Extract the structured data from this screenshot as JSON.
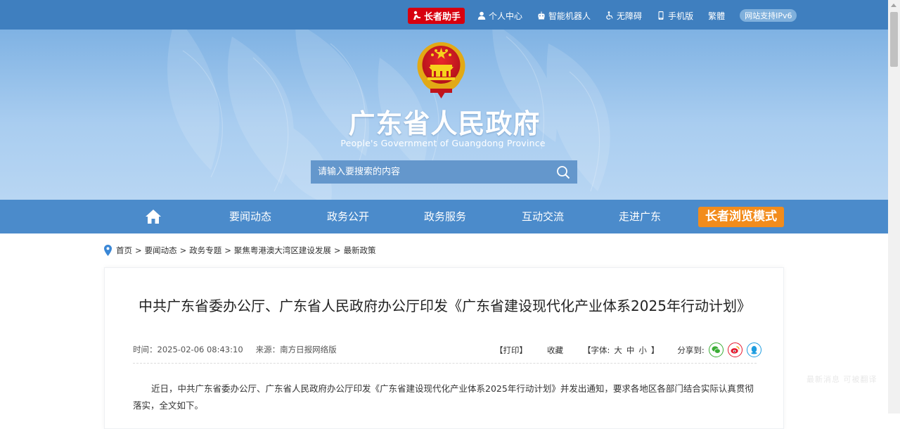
{
  "topbar": {
    "elder_helper": "长者助手",
    "links": [
      {
        "label": "个人中心",
        "icon": "user-icon"
      },
      {
        "label": "智能机器人",
        "icon": "robot-icon"
      },
      {
        "label": "无障碍",
        "icon": "accessibility-icon"
      },
      {
        "label": "手机版",
        "icon": "mobile-icon"
      },
      {
        "label": "繁體",
        "icon": ""
      }
    ],
    "ipv6": "网站支持IPv6"
  },
  "header": {
    "title": "广东省人民政府",
    "subtitle": "People's Government of Guangdong Province",
    "emblem": "national-emblem"
  },
  "search": {
    "placeholder": "请输入要搜索的内容"
  },
  "nav": {
    "items": [
      "要闻动态",
      "政务公开",
      "政务服务",
      "互动交流",
      "走进广东"
    ],
    "elder_mode": "长者浏览模式"
  },
  "breadcrumb": {
    "items": [
      "首页",
      "要闻动态",
      "政务专题",
      "聚焦粤港澳大湾区建设发展",
      "最新政策"
    ],
    "separator": ">"
  },
  "article": {
    "title": "中共广东省委办公厅、广东省人民政府办公厅印发《广东省建设现代化产业体系2025年行动计划》",
    "time": "时间：2025-02-06 08:43:10",
    "source": "来源：南方日报网络版",
    "print": "【打印】",
    "favorite": "收藏",
    "font_prefix": "【字体:",
    "font_large": "大",
    "font_medium": "中",
    "font_small": "小",
    "font_suffix": "】",
    "share_label": "分享到:",
    "share_colors": {
      "wechat": "#3aad35",
      "weibo": "#e6162d",
      "qq": "#1f9de0"
    },
    "body": "近日，中共广东省委办公厅、广东省人民政府办公厅印发《广东省建设现代化产业体系2025年行动计划》并发出通知，要求各地区各部门结合实际认真贯彻落实，全文如下。"
  },
  "floating_note": "最新消息 可被翻译"
}
